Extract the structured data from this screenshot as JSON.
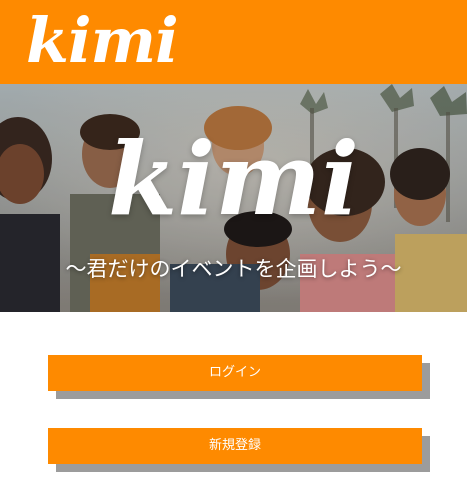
{
  "header": {
    "logo": "kimi"
  },
  "hero": {
    "logo": "kimi",
    "tagline": "〜君だけのイベントを企画しよう〜"
  },
  "actions": {
    "login_label": "ログイン",
    "register_label": "新規登録"
  },
  "colors": {
    "brand_orange": "#fe8a00",
    "button_shadow": "#9c9c9c",
    "background": "#ffffff"
  }
}
